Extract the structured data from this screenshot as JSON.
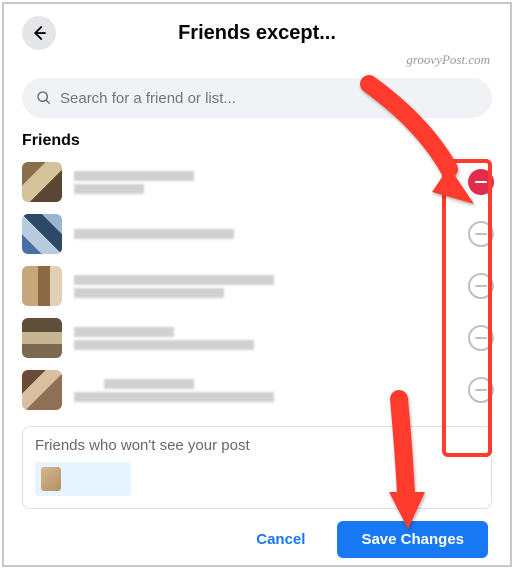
{
  "header": {
    "title": "Friends except..."
  },
  "watermark": "groovyPost.com",
  "search": {
    "placeholder": "Search for a friend or list..."
  },
  "section_label": "Friends",
  "friends": [
    {
      "excluded": true
    },
    {
      "excluded": false
    },
    {
      "excluded": false
    },
    {
      "excluded": false
    },
    {
      "excluded": false
    }
  ],
  "excluded_box": {
    "label": "Friends who won't see your post"
  },
  "footer": {
    "cancel": "Cancel",
    "save": "Save Changes"
  }
}
